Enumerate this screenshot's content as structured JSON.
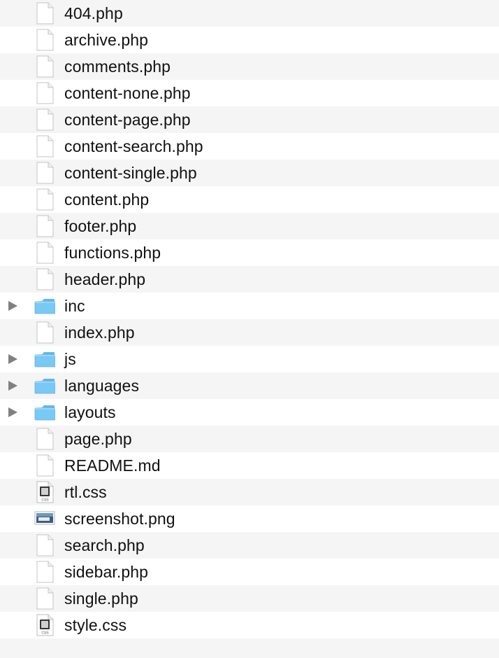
{
  "files": [
    {
      "name": "404.php",
      "kind": "file"
    },
    {
      "name": "archive.php",
      "kind": "file"
    },
    {
      "name": "comments.php",
      "kind": "file"
    },
    {
      "name": "content-none.php",
      "kind": "file"
    },
    {
      "name": "content-page.php",
      "kind": "file"
    },
    {
      "name": "content-search.php",
      "kind": "file"
    },
    {
      "name": "content-single.php",
      "kind": "file"
    },
    {
      "name": "content.php",
      "kind": "file"
    },
    {
      "name": "footer.php",
      "kind": "file"
    },
    {
      "name": "functions.php",
      "kind": "file"
    },
    {
      "name": "header.php",
      "kind": "file"
    },
    {
      "name": "inc",
      "kind": "folder"
    },
    {
      "name": "index.php",
      "kind": "file"
    },
    {
      "name": "js",
      "kind": "folder"
    },
    {
      "name": "languages",
      "kind": "folder"
    },
    {
      "name": "layouts",
      "kind": "folder"
    },
    {
      "name": "page.php",
      "kind": "file"
    },
    {
      "name": "README.md",
      "kind": "file"
    },
    {
      "name": "rtl.css",
      "kind": "css"
    },
    {
      "name": "screenshot.png",
      "kind": "image"
    },
    {
      "name": "search.php",
      "kind": "file"
    },
    {
      "name": "sidebar.php",
      "kind": "file"
    },
    {
      "name": "single.php",
      "kind": "file"
    },
    {
      "name": "style.css",
      "kind": "css"
    }
  ],
  "colors": {
    "row_alt": "#f5f5f5",
    "row": "#ffffff",
    "folder": "#73c2f2",
    "disclosure": "#808080"
  }
}
